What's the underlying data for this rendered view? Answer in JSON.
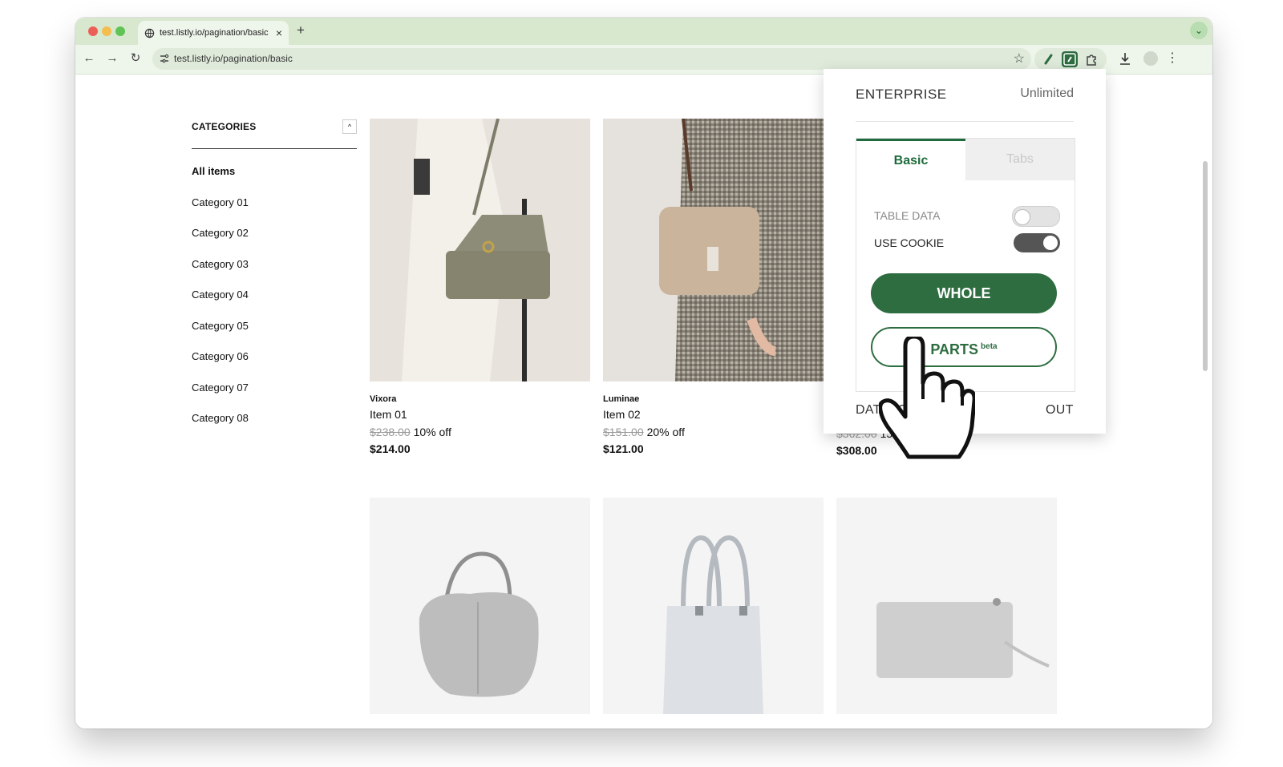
{
  "browser": {
    "tab_title": "test.listly.io/pagination/basic",
    "tab_close": "×",
    "new_tab": "+",
    "url": "test.listly.io/pagination/basic",
    "tab_search": "⌄",
    "back": "←",
    "forward": "→",
    "reload": "↻",
    "bookmark": "☆",
    "menu": "⋮"
  },
  "sidebar": {
    "title": "CATEGORIES",
    "collapse_icon": "^",
    "items": [
      "All items",
      "Category 01",
      "Category 02",
      "Category 03",
      "Category 04",
      "Category 05",
      "Category 06",
      "Category 07",
      "Category 08"
    ]
  },
  "products": [
    {
      "brand": "Vixora",
      "name": "Item 01",
      "old_price": "$238.00",
      "discount": "10% off",
      "price": "$214.00"
    },
    {
      "brand": "Luminae",
      "name": "Item 02",
      "old_price": "$151.00",
      "discount": "20% off",
      "price": "$121.00"
    },
    {
      "old_price": "$362.00",
      "discount": "15% off",
      "price": "$308.00"
    }
  ],
  "popup": {
    "plan": "ENTERPRISE",
    "limit": "Unlimited",
    "tabs": [
      "Basic",
      "Tabs"
    ],
    "options": [
      {
        "label": "TABLE DATA",
        "enabled": false
      },
      {
        "label": "USE COOKIE",
        "enabled": true
      }
    ],
    "whole_button": "WHOLE",
    "parts_button": "PARTS",
    "parts_badge": "beta",
    "databoard_link": "DATABOARD",
    "logout_link": "OUT"
  },
  "colors": {
    "brand_green": "#2e6d40",
    "tab_strip": "#d8e8cf",
    "toolbar": "#eef5ea"
  }
}
